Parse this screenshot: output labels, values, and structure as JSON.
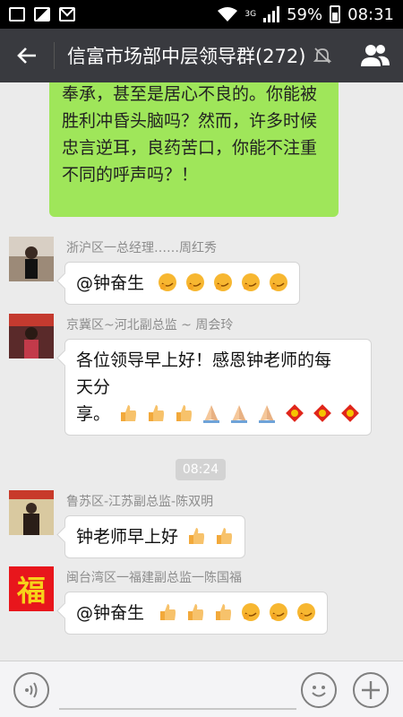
{
  "status_bar": {
    "signal_type": "3G",
    "battery": "59%",
    "time": "08:31"
  },
  "header": {
    "title": "信富市场部中层领导群(272)"
  },
  "previous_message": {
    "lines": [
      "奉承，甚至是居心不良的。你能被",
      "胜利冲昏头脑吗？然而，许多时候",
      "忠言逆耳，良药苦口，你能不注重",
      "不同的呼声吗？！"
    ]
  },
  "messages": [
    {
      "sender": "浙沪区一总经理……周红秀",
      "text": "@钟奋生",
      "emoji": [
        "grin",
        "grin",
        "grin",
        "grin",
        "grin"
      ]
    },
    {
      "sender": "京冀区~河北副总监 ~ 周会玲",
      "lines": [
        "各位领导早上好！感恩钟老师的每",
        "天分",
        "享。"
      ],
      "emoji": [
        "thumbs",
        "thumbs",
        "thumbs",
        "pray",
        "pray",
        "pray",
        "fu",
        "fu",
        "fu"
      ]
    },
    {
      "sender": "鲁苏区-江苏副总监-陈双明",
      "text": "钟老师早上好",
      "emoji": [
        "thumbs",
        "thumbs"
      ]
    },
    {
      "sender": "闽台湾区一福建副总监一陈国福",
      "text": "@钟奋生",
      "emoji": [
        "thumbs",
        "thumbs",
        "thumbs",
        "grin",
        "grin",
        "grin"
      ]
    }
  ],
  "timestamp": "08:24",
  "avatars": {
    "fu_char": "福"
  },
  "colors": {
    "header_bg": "#393a3f",
    "own_bubble": "#9fe65a",
    "chat_bg": "#ebebeb"
  }
}
